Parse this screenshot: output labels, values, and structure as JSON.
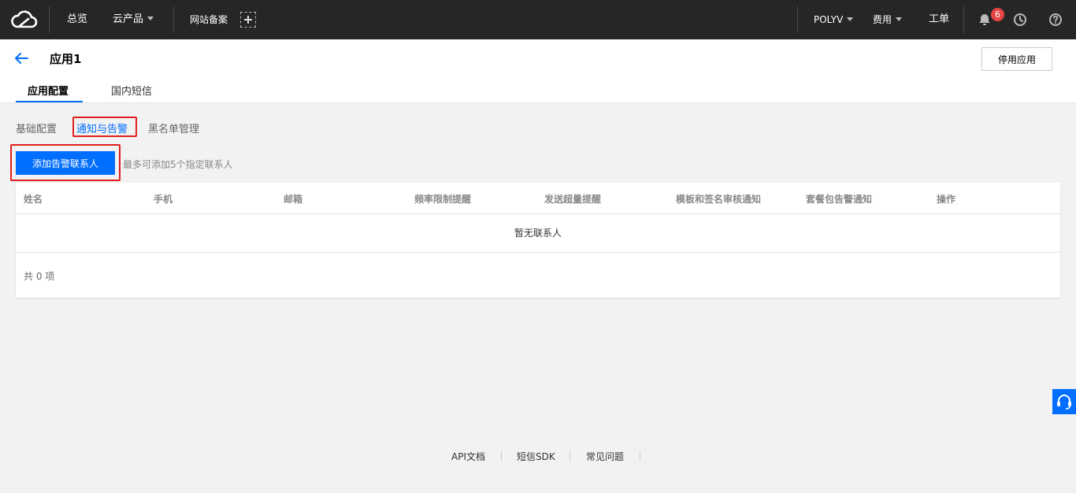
{
  "topnav": {
    "overview": "总览",
    "products": "云产品",
    "icp": "网站备案",
    "account": "POLYV",
    "billing": "费用",
    "tickets": "工单",
    "notifications_count": "6"
  },
  "header": {
    "title": "应用1",
    "disable_button": "停用应用",
    "tabs": [
      "应用配置",
      "国内短信"
    ]
  },
  "subtabs": [
    "基础配置",
    "通知与告警",
    "黑名单管理"
  ],
  "actions": {
    "add_button": "添加告警联系人",
    "hint": "最多可添加5个指定联系人"
  },
  "table": {
    "columns": [
      "姓名",
      "手机",
      "邮箱",
      "频率限制提醒",
      "发送超量提醒",
      "模板和签名审核通知",
      "套餐包告警通知",
      "操作"
    ],
    "empty_text": "暂无联系人",
    "total": "共 0 项"
  },
  "footer": {
    "links": [
      "API文档",
      "短信SDK",
      "常见问题"
    ]
  },
  "colors": {
    "primary": "#006eff",
    "topbar": "#262626",
    "highlight": "#e01f1f",
    "badge": "#e54545"
  }
}
